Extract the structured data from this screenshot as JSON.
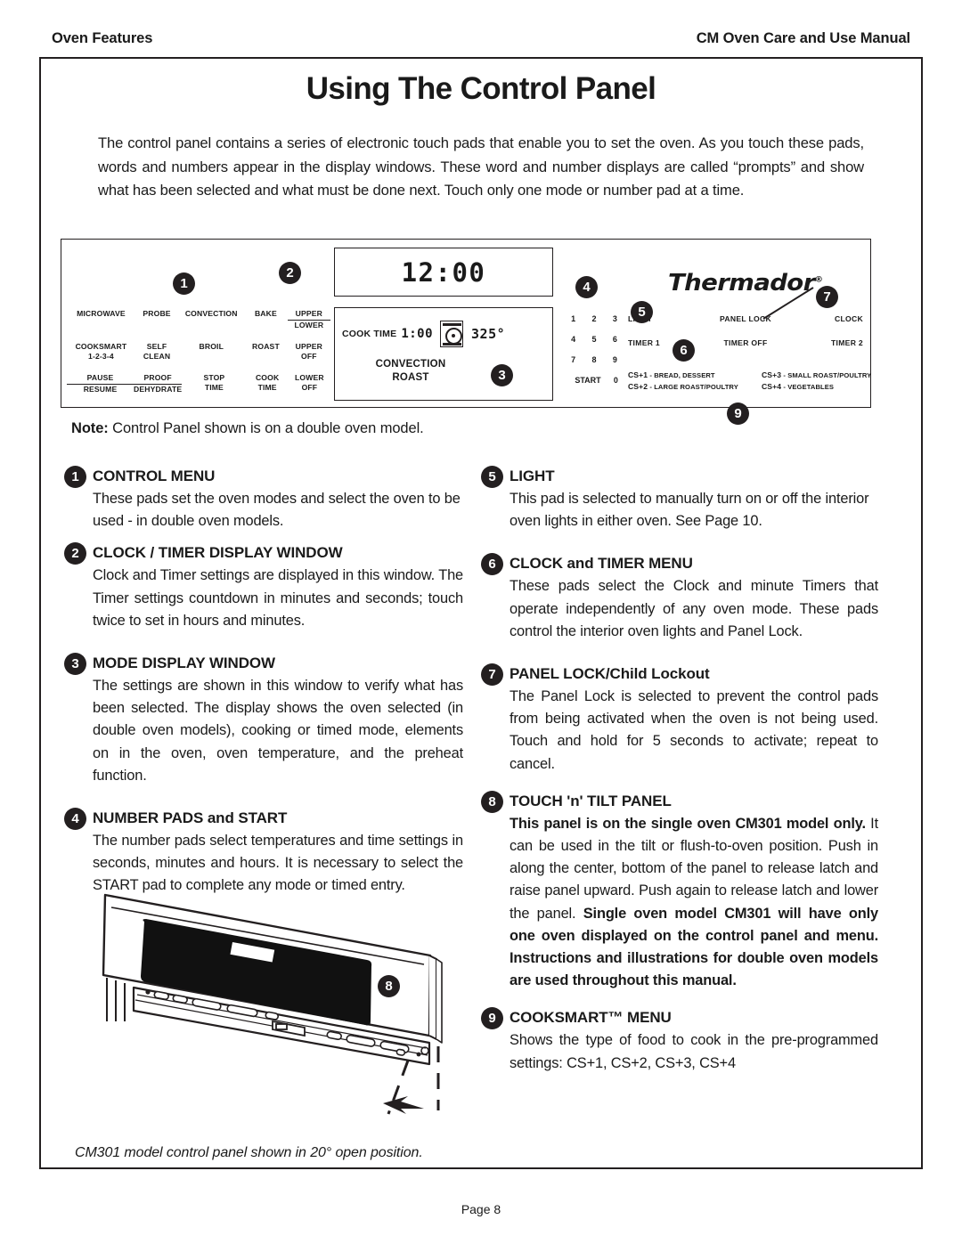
{
  "header": {
    "left": "Oven Features",
    "right": "CM Oven Care and Use Manual"
  },
  "title": "Using The Control Panel",
  "intro": "The control panel contains a series of electronic touch pads that enable you to set the oven. As you touch these pads, words and numbers appear in the display windows. These word and number displays are called “prompts” and show what has been selected and what must be done next. Touch only one mode or number pad at a time.",
  "note_label": "Note:",
  "note_text": " Control Panel shown is on a double oven model.",
  "panel": {
    "brand": "Thermador",
    "brand_mark": "®",
    "pads": [
      [
        {
          "line1": "MICROWAVE"
        },
        {
          "line1": "PROBE"
        },
        {
          "line1": "CONVECTION"
        },
        {
          "line1": "BAKE"
        },
        {
          "line1": "UPPER",
          "line2": "LOWER",
          "underline": true
        }
      ],
      [
        {
          "line1": "COOKSMART",
          "line2": "1-2-3-4"
        },
        {
          "line1": "SELF CLEAN"
        },
        {
          "line1": "BROIL"
        },
        {
          "line1": "ROAST"
        },
        {
          "line1": "UPPER",
          "line2": "OFF"
        }
      ],
      [
        {
          "line1": "PAUSE",
          "line2": "RESUME",
          "underline": true
        },
        {
          "line1": "PROOF",
          "line2": "DEHYDRATE",
          "underline": true
        },
        {
          "line1": "STOP",
          "line2": "TIME"
        },
        {
          "line1": "COOK",
          "line2": "TIME"
        },
        {
          "line1": "LOWER",
          "line2": "OFF"
        }
      ]
    ],
    "clock_display": "12:00",
    "mode_display": {
      "cook_time_label": "COOK TIME",
      "cook_time_value": "1:00",
      "icon": "convection-fan-icon",
      "temperature": "325°",
      "mode_line1": "CONVECTION",
      "mode_line2": "ROAST"
    },
    "numpad": [
      [
        "1",
        "2",
        "3"
      ],
      [
        "4",
        "5",
        "6"
      ],
      [
        "7",
        "8",
        "9"
      ],
      [
        "START",
        "0"
      ]
    ],
    "right_pads": [
      [
        "LIGHT",
        "PANEL LOCK",
        "CLOCK"
      ],
      [
        "TIMER 1",
        "TIMER OFF",
        "TIMER 2"
      ]
    ],
    "cooksmart_legend": [
      {
        "code": "CS+1",
        "desc": " - BREAD, DESSERT"
      },
      {
        "code": "CS+2",
        "desc": " - LARGE ROAST/POULTRY"
      },
      {
        "code": "CS+3",
        "desc": " - SMALL ROAST/POULTRY"
      },
      {
        "code": "CS+4",
        "desc": " - VEGETABLES"
      }
    ],
    "badges": [
      "1",
      "2",
      "3",
      "4",
      "5",
      "6",
      "7",
      "9"
    ]
  },
  "left_items": [
    {
      "num": "1",
      "head": "CONTROL MENU",
      "body": "These pads set the oven modes and select the oven to be used - in double oven models."
    },
    {
      "num": "2",
      "head": "CLOCK / TIMER DISPLAY WINDOW",
      "body": "Clock and Timer settings are displayed in this window. The Timer settings countdown in minutes and seconds; touch twice to set in hours and minutes."
    },
    {
      "num": "3",
      "head": "MODE DISPLAY WINDOW",
      "body": "The settings are shown in this window to verify what has been selected. The display shows the oven selected (in double oven models), cooking or timed mode, elements on in the oven, oven temperature, and the preheat function."
    },
    {
      "num": "4",
      "head": "NUMBER PADS and START",
      "body": "The number pads select temperatures and time settings in seconds, minutes and hours. It is necessary to select the START pad to complete any mode or timed entry."
    }
  ],
  "right_items": [
    {
      "num": "5",
      "head": "LIGHT",
      "body": "This pad is selected to manually turn on or off the interior oven lights in either oven. See Page 10."
    },
    {
      "num": "6",
      "head": "CLOCK and TIMER MENU",
      "body": "These pads select the Clock and minute Timers that operate independently of any oven mode. These pads control the interior oven lights and Panel Lock."
    },
    {
      "num": "7",
      "head": "PANEL LOCK/Child Lockout",
      "body": "The Panel Lock is selected to prevent the control pads from being activated when the oven is not being used. Touch and hold for 5 seconds to activate; repeat to cancel."
    },
    {
      "num": "8",
      "head": "TOUCH 'n' TILT PANEL",
      "body_bold_1": "This panel is on the single oven CM301 model only.",
      "body_mid": " It can be used in the tilt or flush-to-oven position. Push in along the center, bottom of the panel to release latch and raise panel upward. Push again to release latch and lower the panel. ",
      "body_bold_2": "Single oven model CM301 will have only one oven displayed on the control panel and menu. Instructions and illustrations for double oven models are used throughout this manual."
    },
    {
      "num": "9",
      "head": "COOKSMART™ MENU",
      "body": "Shows the type of food to cook in the pre-programmed settings: CS+1, CS+2, CS+3, CS+4"
    }
  ],
  "figure": {
    "badge": "8",
    "caption": "CM301 model control panel shown in 20° open position."
  },
  "footer": "Page 8"
}
